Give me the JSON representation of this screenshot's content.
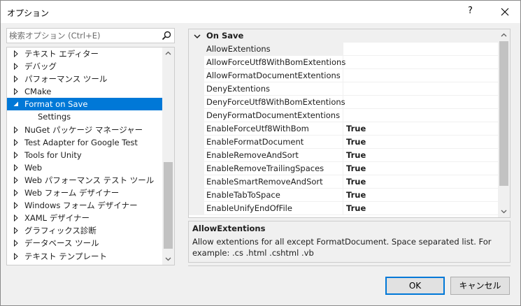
{
  "window": {
    "title": "オプション",
    "help_label": "?"
  },
  "search": {
    "placeholder": "検索オプション (Ctrl+E)"
  },
  "tree": {
    "items": [
      {
        "label": "テキスト エディター",
        "expandable": true,
        "selected": false,
        "child": false
      },
      {
        "label": "デバッグ",
        "expandable": true,
        "selected": false,
        "child": false
      },
      {
        "label": "パフォーマンス ツール",
        "expandable": true,
        "selected": false,
        "child": false
      },
      {
        "label": "CMake",
        "expandable": true,
        "selected": false,
        "child": false
      },
      {
        "label": "Format on Save",
        "expandable": true,
        "expanded": true,
        "selected": true,
        "child": false
      },
      {
        "label": "Settings",
        "expandable": false,
        "selected": false,
        "child": true
      },
      {
        "label": "NuGet パッケージ マネージャー",
        "expandable": true,
        "selected": false,
        "child": false
      },
      {
        "label": "Test Adapter for Google Test",
        "expandable": true,
        "selected": false,
        "child": false
      },
      {
        "label": "Tools for Unity",
        "expandable": true,
        "selected": false,
        "child": false
      },
      {
        "label": "Web",
        "expandable": true,
        "selected": false,
        "child": false
      },
      {
        "label": "Web パフォーマンス テスト ツール",
        "expandable": true,
        "selected": false,
        "child": false
      },
      {
        "label": "Web フォーム デザイナー",
        "expandable": true,
        "selected": false,
        "child": false
      },
      {
        "label": "Windows フォーム デザイナー",
        "expandable": true,
        "selected": false,
        "child": false
      },
      {
        "label": "XAML デザイナー",
        "expandable": true,
        "selected": false,
        "child": false
      },
      {
        "label": "グラフィックス診断",
        "expandable": true,
        "selected": false,
        "child": false
      },
      {
        "label": "データベース ツール",
        "expandable": true,
        "selected": false,
        "child": false
      },
      {
        "label": "テキスト テンプレート",
        "expandable": true,
        "selected": false,
        "child": false
      }
    ]
  },
  "property_grid": {
    "category": "On Save",
    "rows": [
      {
        "name": "AllowExtentions",
        "value": "",
        "selected": true
      },
      {
        "name": "AllowForceUtf8WithBomExtentions",
        "value": "",
        "selected": false
      },
      {
        "name": "AllowFormatDocumentExtentions",
        "value": "",
        "selected": false
      },
      {
        "name": "DenyExtentions",
        "value": "",
        "selected": false
      },
      {
        "name": "DenyForceUtf8WithBomExtentions",
        "value": "",
        "selected": false
      },
      {
        "name": "DenyFormatDocumentExtentions",
        "value": "",
        "selected": false
      },
      {
        "name": "EnableForceUtf8WithBom",
        "value": "True",
        "selected": false
      },
      {
        "name": "EnableFormatDocument",
        "value": "True",
        "selected": false
      },
      {
        "name": "EnableRemoveAndSort",
        "value": "True",
        "selected": false
      },
      {
        "name": "EnableRemoveTrailingSpaces",
        "value": "True",
        "selected": false
      },
      {
        "name": "EnableSmartRemoveAndSort",
        "value": "True",
        "selected": false
      },
      {
        "name": "EnableTabToSpace",
        "value": "True",
        "selected": false
      },
      {
        "name": "EnableUnifyEndOfFile",
        "value": "True",
        "selected": false
      }
    ]
  },
  "description": {
    "title": "AllowExtentions",
    "text": "Allow extentions for all except FormatDocument. Space separated list. For example: .cs .html .cshtml .vb"
  },
  "buttons": {
    "ok": "OK",
    "cancel": "キャンセル"
  },
  "colors": {
    "selection": "#0078d7",
    "dialog_bg": "#f0f0f0"
  }
}
